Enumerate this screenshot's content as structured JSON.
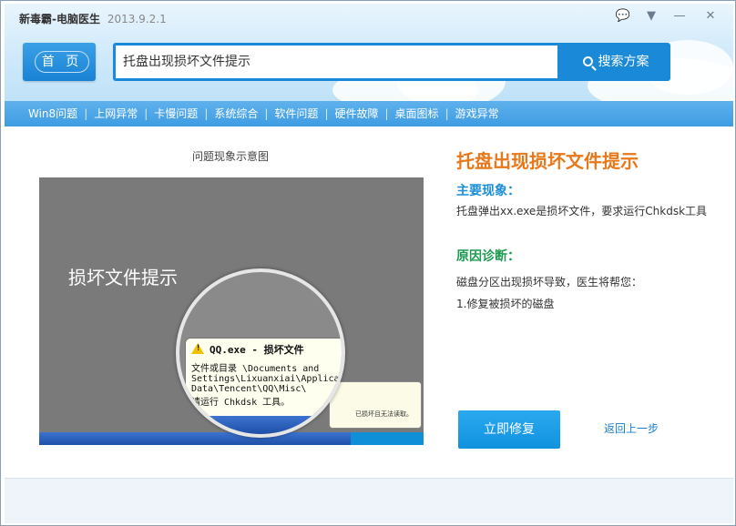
{
  "window": {
    "app_name": "新毒霸-电脑医生",
    "version": "2013.9.2.1"
  },
  "header": {
    "home_label": "首 页",
    "search_value": "托盘出现损坏文件提示",
    "search_button_label": "搜索方案"
  },
  "categories": [
    "Win8问题",
    "上网异常",
    "卡慢问题",
    "系统综合",
    "软件问题",
    "硬件故障",
    "桌面图标",
    "游戏异常"
  ],
  "illustration": {
    "caption": "问题现象示意图",
    "big_text": "损坏文件提示",
    "balloon_title": "QQ.exe - 损坏文件",
    "balloon_lines": [
      "文件或目录 \\Documents and",
      "Settings\\Lixuanxiai\\Applica",
      "Data\\Tencent\\QQ\\Misc\\",
      "请运行 Chkdsk 工具。"
    ],
    "mini_text": "已损坏且无法读取。"
  },
  "issue": {
    "title": "托盘出现损坏文件提示",
    "symptom_heading": "主要现象：",
    "symptom_text": "托盘弹出xx.exe是损坏文件，要求运行Chkdsk工具",
    "diagnosis_heading": "原因诊断：",
    "diagnosis_text": "磁盘分区出现损坏导致，医生将帮您：",
    "fix_step": "1.修复被损坏的磁盘"
  },
  "actions": {
    "repair_label": "立即修复",
    "back_label": "返回上一步"
  },
  "colors": {
    "accent_blue": "#1a8ad8",
    "title_orange": "#e87819",
    "heading_blue": "#1e8fd6",
    "heading_green": "#1e9a52"
  }
}
